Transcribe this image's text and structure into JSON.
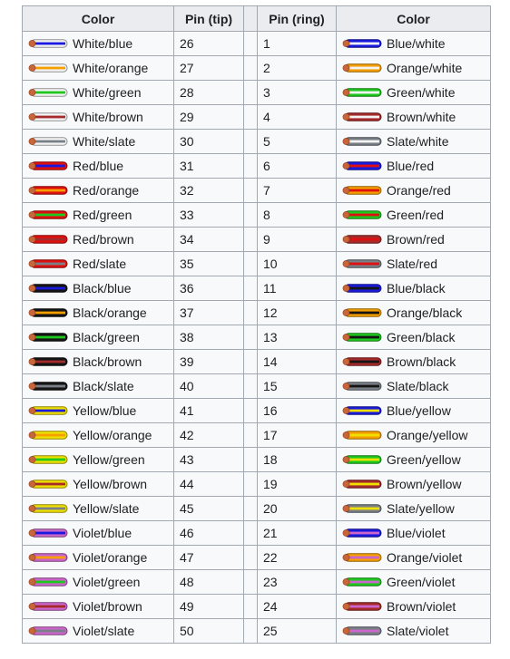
{
  "headers": {
    "color_left": "Color",
    "pin_tip": "Pin (tip)",
    "gap": "",
    "pin_ring": "Pin (ring)",
    "color_right": "Color"
  },
  "colors": {
    "white": "#f4f4f4",
    "blue": "#1a1adf",
    "orange": "#f5a000",
    "green": "#1ec81e",
    "brown": "#a52a2a",
    "slate": "#7a8087",
    "red": "#e01010",
    "black": "#151515",
    "yellow": "#f0e000",
    "violet": "#cc66cc",
    "copper": "#c8663a",
    "border": "#a2a9b1",
    "header_bg": "#eaecf0",
    "cell_bg": "#f8f9fa"
  },
  "rows": [
    {
      "tip_label": "White/blue",
      "tip_pin": "26",
      "ring_pin": "1",
      "ring_label": "Blue/white",
      "tip_insulation": "white",
      "tip_stripe": "blue",
      "ring_insulation": "blue",
      "ring_stripe": "white"
    },
    {
      "tip_label": "White/orange",
      "tip_pin": "27",
      "ring_pin": "2",
      "ring_label": "Orange/white",
      "tip_insulation": "white",
      "tip_stripe": "orange",
      "ring_insulation": "orange",
      "ring_stripe": "white"
    },
    {
      "tip_label": "White/green",
      "tip_pin": "28",
      "ring_pin": "3",
      "ring_label": "Green/white",
      "tip_insulation": "white",
      "tip_stripe": "green",
      "ring_insulation": "green",
      "ring_stripe": "white"
    },
    {
      "tip_label": "White/brown",
      "tip_pin": "29",
      "ring_pin": "4",
      "ring_label": "Brown/white",
      "tip_insulation": "white",
      "tip_stripe": "brown",
      "ring_insulation": "brown",
      "ring_stripe": "white"
    },
    {
      "tip_label": "White/slate",
      "tip_pin": "30",
      "ring_pin": "5",
      "ring_label": "Slate/white",
      "tip_insulation": "white",
      "tip_stripe": "slate",
      "ring_insulation": "slate",
      "ring_stripe": "white"
    },
    {
      "tip_label": "Red/blue",
      "tip_pin": "31",
      "ring_pin": "6",
      "ring_label": "Blue/red",
      "tip_insulation": "red",
      "tip_stripe": "blue",
      "ring_insulation": "blue",
      "ring_stripe": "red"
    },
    {
      "tip_label": "Red/orange",
      "tip_pin": "32",
      "ring_pin": "7",
      "ring_label": "Orange/red",
      "tip_insulation": "red",
      "tip_stripe": "orange",
      "ring_insulation": "orange",
      "ring_stripe": "red"
    },
    {
      "tip_label": "Red/green",
      "tip_pin": "33",
      "ring_pin": "8",
      "ring_label": "Green/red",
      "tip_insulation": "red",
      "tip_stripe": "green",
      "ring_insulation": "green",
      "ring_stripe": "red"
    },
    {
      "tip_label": "Red/brown",
      "tip_pin": "34",
      "ring_pin": "9",
      "ring_label": "Brown/red",
      "tip_insulation": "red",
      "tip_stripe": "brown",
      "ring_insulation": "brown",
      "ring_stripe": "red"
    },
    {
      "tip_label": "Red/slate",
      "tip_pin": "35",
      "ring_pin": "10",
      "ring_label": "Slate/red",
      "tip_insulation": "red",
      "tip_stripe": "slate",
      "ring_insulation": "slate",
      "ring_stripe": "red"
    },
    {
      "tip_label": "Black/blue",
      "tip_pin": "36",
      "ring_pin": "11",
      "ring_label": "Blue/black",
      "tip_insulation": "black",
      "tip_stripe": "blue",
      "ring_insulation": "blue",
      "ring_stripe": "black"
    },
    {
      "tip_label": "Black/orange",
      "tip_pin": "37",
      "ring_pin": "12",
      "ring_label": "Orange/black",
      "tip_insulation": "black",
      "tip_stripe": "orange",
      "ring_insulation": "orange",
      "ring_stripe": "black"
    },
    {
      "tip_label": "Black/green",
      "tip_pin": "38",
      "ring_pin": "13",
      "ring_label": "Green/black",
      "tip_insulation": "black",
      "tip_stripe": "green",
      "ring_insulation": "green",
      "ring_stripe": "black"
    },
    {
      "tip_label": "Black/brown",
      "tip_pin": "39",
      "ring_pin": "14",
      "ring_label": "Brown/black",
      "tip_insulation": "black",
      "tip_stripe": "brown",
      "ring_insulation": "brown",
      "ring_stripe": "black"
    },
    {
      "tip_label": "Black/slate",
      "tip_pin": "40",
      "ring_pin": "15",
      "ring_label": "Slate/black",
      "tip_insulation": "black",
      "tip_stripe": "slate",
      "ring_insulation": "slate",
      "ring_stripe": "black"
    },
    {
      "tip_label": "Yellow/blue",
      "tip_pin": "41",
      "ring_pin": "16",
      "ring_label": "Blue/yellow",
      "tip_insulation": "yellow",
      "tip_stripe": "blue",
      "ring_insulation": "blue",
      "ring_stripe": "yellow"
    },
    {
      "tip_label": "Yellow/orange",
      "tip_pin": "42",
      "ring_pin": "17",
      "ring_label": "Orange/yellow",
      "tip_insulation": "yellow",
      "tip_stripe": "orange",
      "ring_insulation": "orange",
      "ring_stripe": "yellow"
    },
    {
      "tip_label": "Yellow/green",
      "tip_pin": "43",
      "ring_pin": "18",
      "ring_label": "Green/yellow",
      "tip_insulation": "yellow",
      "tip_stripe": "green",
      "ring_insulation": "green",
      "ring_stripe": "yellow"
    },
    {
      "tip_label": "Yellow/brown",
      "tip_pin": "44",
      "ring_pin": "19",
      "ring_label": "Brown/yellow",
      "tip_insulation": "yellow",
      "tip_stripe": "brown",
      "ring_insulation": "brown",
      "ring_stripe": "yellow"
    },
    {
      "tip_label": "Yellow/slate",
      "tip_pin": "45",
      "ring_pin": "20",
      "ring_label": "Slate/yellow",
      "tip_insulation": "yellow",
      "tip_stripe": "slate",
      "ring_insulation": "slate",
      "ring_stripe": "yellow"
    },
    {
      "tip_label": "Violet/blue",
      "tip_pin": "46",
      "ring_pin": "21",
      "ring_label": "Blue/violet",
      "tip_insulation": "violet",
      "tip_stripe": "blue",
      "ring_insulation": "blue",
      "ring_stripe": "violet"
    },
    {
      "tip_label": "Violet/orange",
      "tip_pin": "47",
      "ring_pin": "22",
      "ring_label": "Orange/violet",
      "tip_insulation": "violet",
      "tip_stripe": "orange",
      "ring_insulation": "orange",
      "ring_stripe": "violet"
    },
    {
      "tip_label": "Violet/green",
      "tip_pin": "48",
      "ring_pin": "23",
      "ring_label": "Green/violet",
      "tip_insulation": "violet",
      "tip_stripe": "green",
      "ring_insulation": "green",
      "ring_stripe": "violet"
    },
    {
      "tip_label": "Violet/brown",
      "tip_pin": "49",
      "ring_pin": "24",
      "ring_label": "Brown/violet",
      "tip_insulation": "violet",
      "tip_stripe": "brown",
      "ring_insulation": "brown",
      "ring_stripe": "violet"
    },
    {
      "tip_label": "Violet/slate",
      "tip_pin": "50",
      "ring_pin": "25",
      "ring_label": "Slate/violet",
      "tip_insulation": "violet",
      "tip_stripe": "slate",
      "ring_insulation": "slate",
      "ring_stripe": "violet"
    }
  ]
}
